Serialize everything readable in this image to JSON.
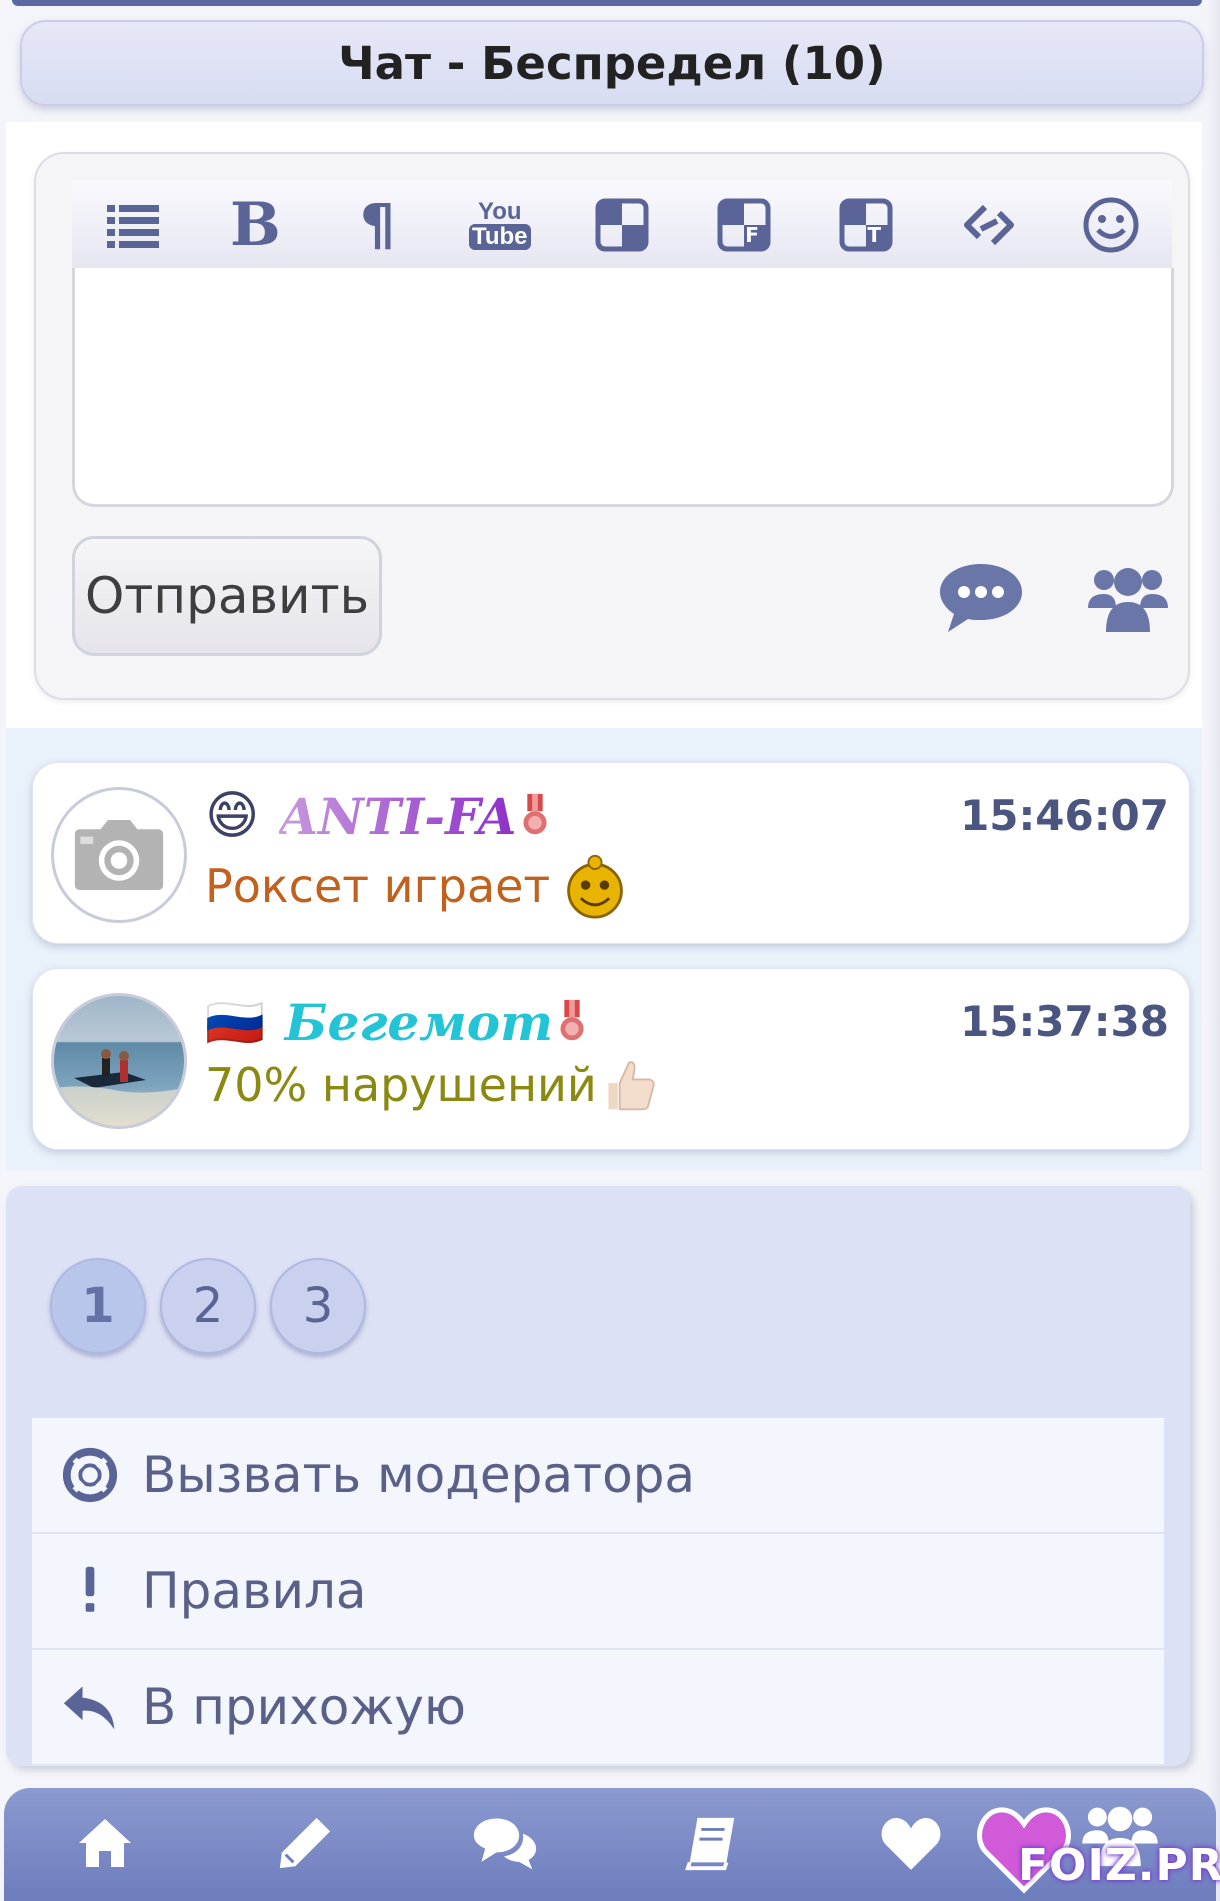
{
  "header": {
    "title": "Чат - Беспредел (10)"
  },
  "editor": {
    "toolbar_icons": [
      "list-icon",
      "bold-icon",
      "paragraph-icon",
      "youtube-icon",
      "spoiler-icon",
      "spoiler-f-icon",
      "spoiler-t-icon",
      "link-icon",
      "smiley-icon"
    ],
    "bold_glyph": "B",
    "paragraph_glyph": "¶",
    "youtube_top": "You",
    "youtube_bottom": "Tube",
    "spoiler_f_letter": "F",
    "spoiler_t_letter": "T",
    "textarea_value": "",
    "send_label": "Отправить"
  },
  "messages": [
    {
      "nick": "ANTI-FA",
      "nick_color": "#9b3fd0",
      "time": "15:46:07",
      "text": "Роксет играет",
      "text_color": "#c0621e",
      "emoji": "😄",
      "avatar": "camera-placeholder"
    },
    {
      "nick": "Бегемот",
      "nick_color": "#22c4d6",
      "time": "15:37:38",
      "text": "70% нарушений",
      "text_color": "#8a8a12",
      "emoji": "🇷🇺",
      "avatar": "sea-photo"
    }
  ],
  "pagination": {
    "pages": [
      "1",
      "2",
      "3"
    ],
    "current": "1"
  },
  "menu": [
    {
      "label": "Вызвать модератора",
      "icon": "lifebuoy-icon"
    },
    {
      "label": "Правила",
      "icon": "exclamation-icon"
    },
    {
      "label": "В прихожую",
      "icon": "reply-icon"
    }
  ],
  "navbar": {
    "items": [
      "home-icon",
      "pencil-icon",
      "chat-icon",
      "book-icon",
      "heart-icon",
      "users-icon"
    ]
  },
  "logo": {
    "text": "FOIZ.PRO"
  },
  "colors": {
    "accent": "#6d7dbd",
    "title_bg": "#dde1f5",
    "message_area": "#e9f1fb"
  }
}
